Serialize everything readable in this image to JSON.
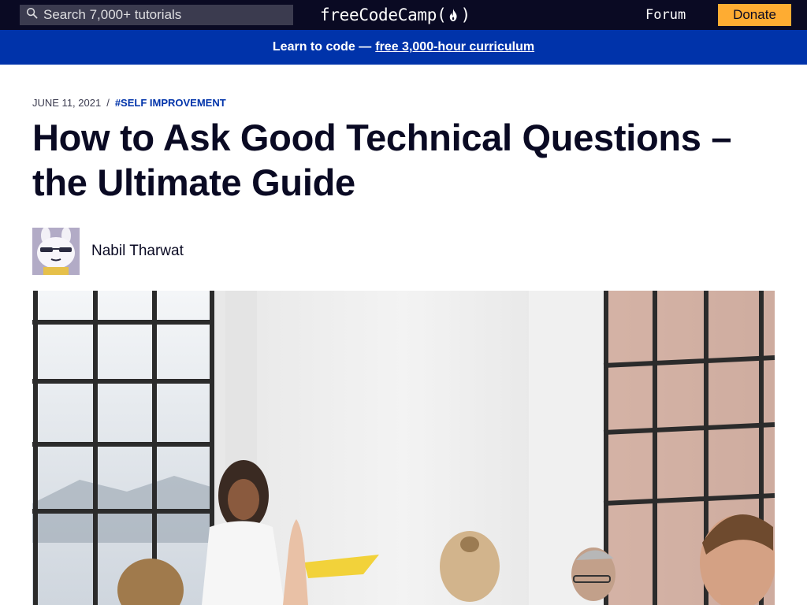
{
  "nav": {
    "search_placeholder": "Search 7,000+ tutorials",
    "logo_text_left": "freeCodeCamp(",
    "logo_text_right": ")",
    "forum_label": "Forum",
    "donate_label": "Donate"
  },
  "banner": {
    "lead_text": "Learn to code —",
    "link_text": "free 3,000-hour curriculum"
  },
  "article": {
    "date": "JUNE 11, 2021",
    "separator": "/",
    "tag": "#SELF IMPROVEMENT",
    "title": "How to Ask Good Technical Questions – the Ultimate Guide",
    "author_name": "Nabil Tharwat"
  },
  "colors": {
    "nav_bg": "#0a0a23",
    "banner_bg": "#0033aa",
    "donate_bg": "#feac32",
    "tag_color": "#0033aa"
  },
  "icons": {
    "search": "magnifier",
    "logo_mark": "flame",
    "avatar": "cartoon-character",
    "feature_image": "classroom-photo"
  }
}
